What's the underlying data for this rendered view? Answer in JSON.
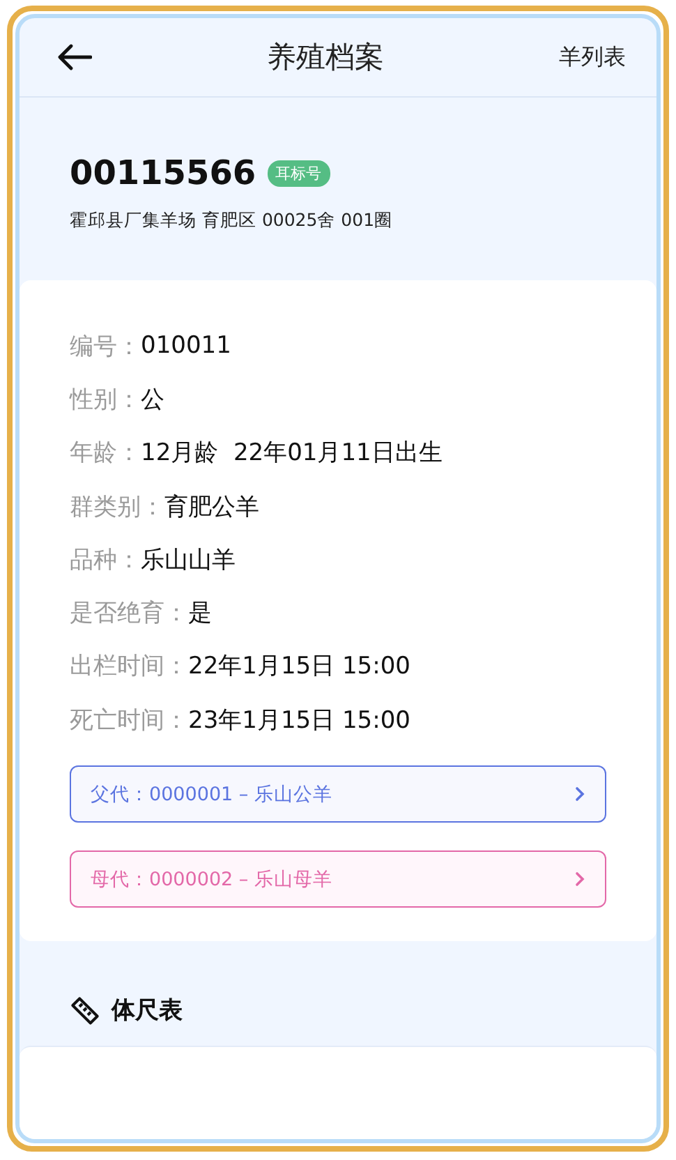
{
  "header": {
    "title": "养殖档案",
    "action": "羊列表"
  },
  "animal": {
    "ear_tag": "00115566",
    "tag_badge": "耳标号",
    "location": "霍邱县厂集羊场 育肥区 00025舍 001圈"
  },
  "fields": [
    {
      "label": "编号：",
      "value": "010011"
    },
    {
      "label": "性别：",
      "value": "公"
    },
    {
      "label": "年龄：",
      "value": "12月龄  22年01月11日出生"
    },
    {
      "label": "群类别：",
      "value": "育肥公羊"
    },
    {
      "label": "品种：",
      "value": "乐山山羊"
    },
    {
      "label": "是否绝育：",
      "value": "是"
    },
    {
      "label": "出栏时间：",
      "value": "22年1月15日 15:00"
    },
    {
      "label": "死亡时间：",
      "value": "23年1月15日 15:00"
    }
  ],
  "parents": [
    {
      "kind": "father",
      "text": "父代：0000001 – 乐山公羊",
      "color": "#5b74e0"
    },
    {
      "kind": "mother",
      "text": "母代：0000002 – 乐山母羊",
      "color": "#e368a8"
    }
  ],
  "section": {
    "title": "体尺表"
  }
}
